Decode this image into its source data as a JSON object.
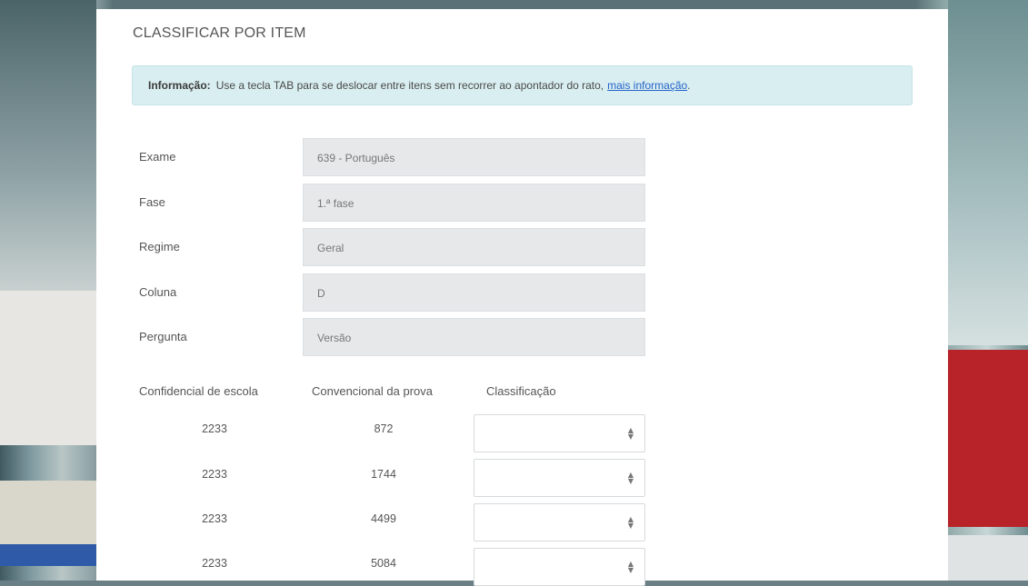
{
  "page_title": "CLASSIFICAR POR ITEM",
  "info": {
    "label": "Informação:",
    "text": "Use a tecla TAB para se deslocar entre itens sem recorrer ao apontador do rato,",
    "link": "mais informação"
  },
  "fields": [
    {
      "label": "Exame",
      "value": "639 - Português"
    },
    {
      "label": "Fase",
      "value": "1.ª fase"
    },
    {
      "label": "Regime",
      "value": "Geral"
    },
    {
      "label": "Coluna",
      "value": "D"
    },
    {
      "label": "Pergunta",
      "value": "Versão"
    }
  ],
  "table": {
    "headers": [
      "Confidencial de escola",
      "Convencional da prova",
      "Classificação"
    ],
    "rows": [
      {
        "escola": "2233",
        "prova": "872",
        "classificacao": ""
      },
      {
        "escola": "2233",
        "prova": "1744",
        "classificacao": ""
      },
      {
        "escola": "2233",
        "prova": "4499",
        "classificacao": ""
      },
      {
        "escola": "2233",
        "prova": "5084",
        "classificacao": ""
      }
    ]
  }
}
